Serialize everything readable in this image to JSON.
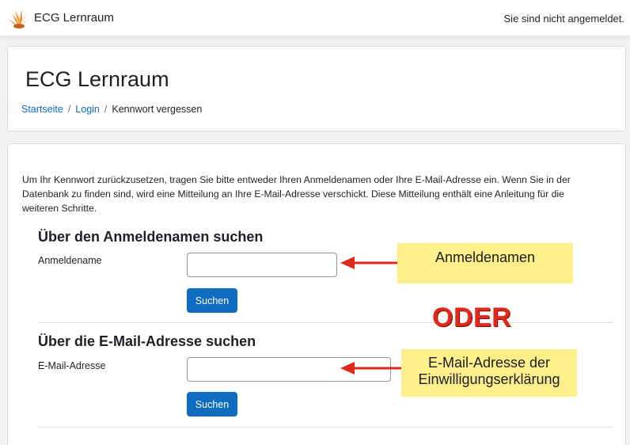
{
  "navbar": {
    "site_name": "ECG Lernraum",
    "login_status": "Sie sind nicht angemeldet."
  },
  "header": {
    "title": "ECG Lernraum",
    "breadcrumb": [
      "Startseite",
      "Login",
      "Kennwort vergessen"
    ]
  },
  "main": {
    "instructions": "Um Ihr Kennwort zurückzusetzen, tragen Sie bitte entweder Ihren Anmeldenamen oder Ihre E-Mail-Adresse ein. Wenn Sie in der Datenbank zu finden sind, wird eine Mitteilung an Ihre E-Mail-Adresse verschickt. Diese Mitteilung enthält eine Anleitung für die weiteren Schritte.",
    "username_section": {
      "title": "Über den Anmeldenamen suchen",
      "label": "Anmeldename",
      "value": "",
      "button": "Suchen"
    },
    "email_section": {
      "title": "Über die E-Mail-Adresse suchen",
      "label": "E-Mail-Adresse",
      "value": "",
      "button": "Suchen"
    }
  },
  "annotations": {
    "username_note": "Anmeldenamen",
    "or_text": "ODER",
    "email_note_line1": "E-Mail-Adresse der",
    "email_note_line2": "Einwilligungserklärung",
    "highlight_color": "#fdf08a",
    "arrow_color": "#e0281b"
  },
  "colors": {
    "accent": "#0f6cbf"
  }
}
